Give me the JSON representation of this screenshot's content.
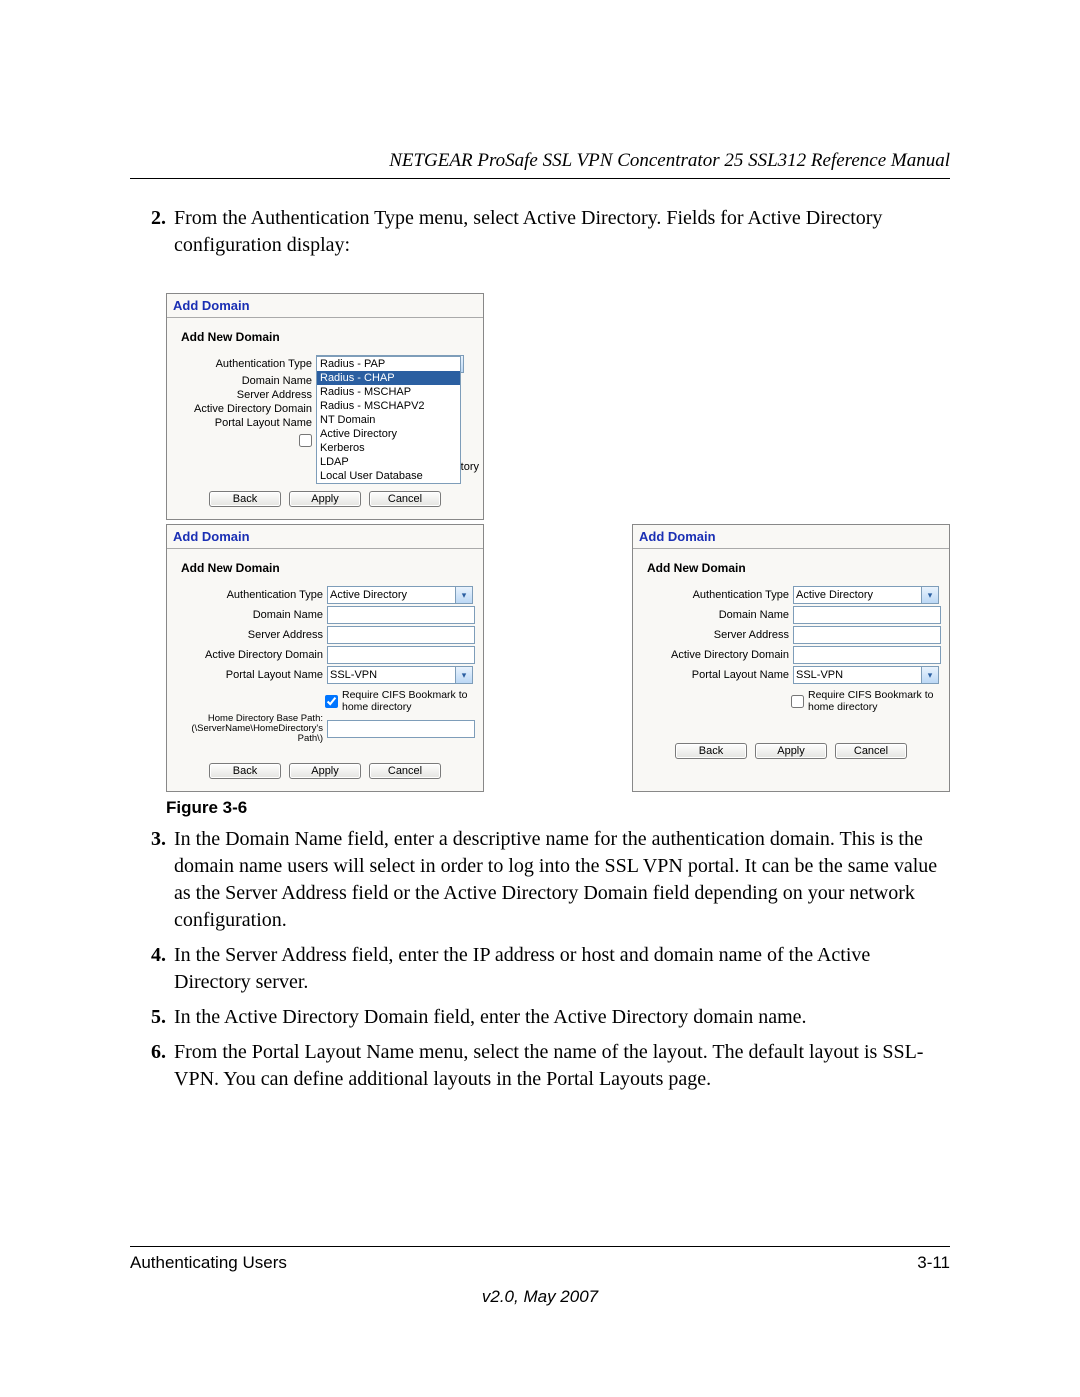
{
  "header": {
    "title": "NETGEAR ProSafe SSL VPN Concentrator 25 SSL312 Reference Manual"
  },
  "steps": {
    "s2": {
      "num": "2.",
      "text": "From the Authentication Type menu, select Active Directory. Fields for Active Directory configuration display:"
    },
    "s3": {
      "num": "3.",
      "text": "In the Domain Name field, enter a descriptive name for the authentication domain. This is the domain name users will select in order to log into the SSL VPN portal. It can be the same value as the Server Address field or the Active Directory Domain field depending on your network configuration."
    },
    "s4": {
      "num": "4.",
      "text": "In the Server Address field, enter the IP address or host and domain name of the Active Directory server."
    },
    "s5": {
      "num": "5.",
      "text": "In the Active Directory Domain field, enter the Active Directory domain name."
    },
    "s6": {
      "num": "6.",
      "text": "From the Portal Layout Name menu, select the name of the layout. The default layout is SSL-VPN. You can define additional layouts in the Portal Layouts page."
    }
  },
  "figure_caption": "Figure 3-6",
  "panelA": {
    "title": "Add Domain",
    "section": "Add New Domain",
    "labels": {
      "auth_type": "Authentication Type",
      "domain_name": "Domain Name",
      "server_addr": "Server Address",
      "ad_domain": "Active Directory Domain",
      "portal": "Portal Layout Name"
    },
    "auth_type_selected": "Active Directory",
    "dropdown": [
      "Radius - PAP",
      "Radius - CHAP",
      "Radius - MSCHAP",
      "Radius - MSCHAPV2",
      "NT Domain",
      "Active Directory",
      "Kerberos",
      "LDAP",
      "Local User Database"
    ],
    "dropdown_highlight_index": 1,
    "tory_fragment": "tory",
    "buttons": {
      "back": "Back",
      "apply": "Apply",
      "cancel": "Cancel"
    }
  },
  "panelB": {
    "title": "Add Domain",
    "section": "Add New Domain",
    "labels": {
      "auth_type": "Authentication Type",
      "domain_name": "Domain Name",
      "server_addr": "Server Address",
      "ad_domain": "Active Directory Domain",
      "portal": "Portal Layout Name",
      "cifs": "Require CIFS Bookmark to home directory",
      "home_path": "Home Directory Base Path:\n(\\ServerName\\HomeDirectory's Path\\)"
    },
    "auth_type_selected": "Active Directory",
    "portal_selected": "SSL-VPN",
    "cifs_checked": true,
    "buttons": {
      "back": "Back",
      "apply": "Apply",
      "cancel": "Cancel"
    }
  },
  "panelC": {
    "title": "Add Domain",
    "section": "Add New Domain",
    "labels": {
      "auth_type": "Authentication Type",
      "domain_name": "Domain Name",
      "server_addr": "Server Address",
      "ad_domain": "Active Directory Domain",
      "portal": "Portal Layout Name",
      "cifs": "Require CIFS Bookmark to home directory"
    },
    "auth_type_selected": "Active Directory",
    "portal_selected": "SSL-VPN",
    "cifs_checked": false,
    "buttons": {
      "back": "Back",
      "apply": "Apply",
      "cancel": "Cancel"
    }
  },
  "footer": {
    "left": "Authenticating Users",
    "right": "3-11",
    "version": "v2.0, May 2007"
  }
}
